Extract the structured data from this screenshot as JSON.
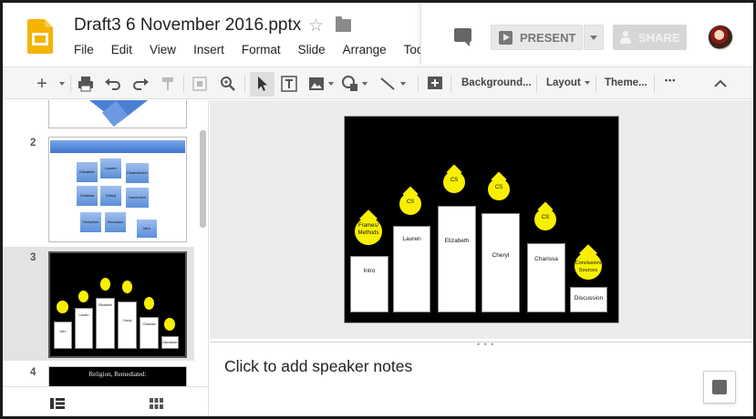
{
  "window": {
    "title": "Draft3 6 November 2016.pptx"
  },
  "menu": [
    "File",
    "Edit",
    "View",
    "Insert",
    "Format",
    "Slide",
    "Arrange",
    "Tools"
  ],
  "header": {
    "present_label": "PRESENT",
    "share_label": "SHARE"
  },
  "toolbar": {
    "background_label": "Background...",
    "layout_label": "Layout",
    "theme_label": "Theme...",
    "more_label": "•••"
  },
  "filmstrip": {
    "slides": [
      {
        "number": "2",
        "labels": [
          "Elizabeth",
          "Lauren",
          "Elizabeth/Ann",
          "Charissa",
          "Cheryl",
          "Lauren/Ann",
          "Cheryl/Ann",
          "Discussion",
          "Intro"
        ]
      },
      {
        "number": "3"
      },
      {
        "number": "4",
        "preview_text": "Religion, Remediated:"
      }
    ],
    "slide1_number": ""
  },
  "slide": {
    "bars": [
      {
        "label": "Intro"
      },
      {
        "label": "Lauren"
      },
      {
        "label": "Elizabeth"
      },
      {
        "label": "Cheryl"
      },
      {
        "label": "Charissa"
      },
      {
        "label": "Discussion"
      }
    ],
    "drops": [
      {
        "label": "Frames/ Methods"
      },
      {
        "label": "CS"
      },
      {
        "label": "CS"
      },
      {
        "label": "CS"
      },
      {
        "label": "CS"
      },
      {
        "label": "Conclusion/ Sources"
      }
    ]
  },
  "notes": {
    "placeholder": "Click to add speaker notes"
  },
  "colors": {
    "slides_yellow": "#f4b400",
    "drop_yellow": "#f8f000",
    "thumb_blue": "#5b8fd8"
  }
}
